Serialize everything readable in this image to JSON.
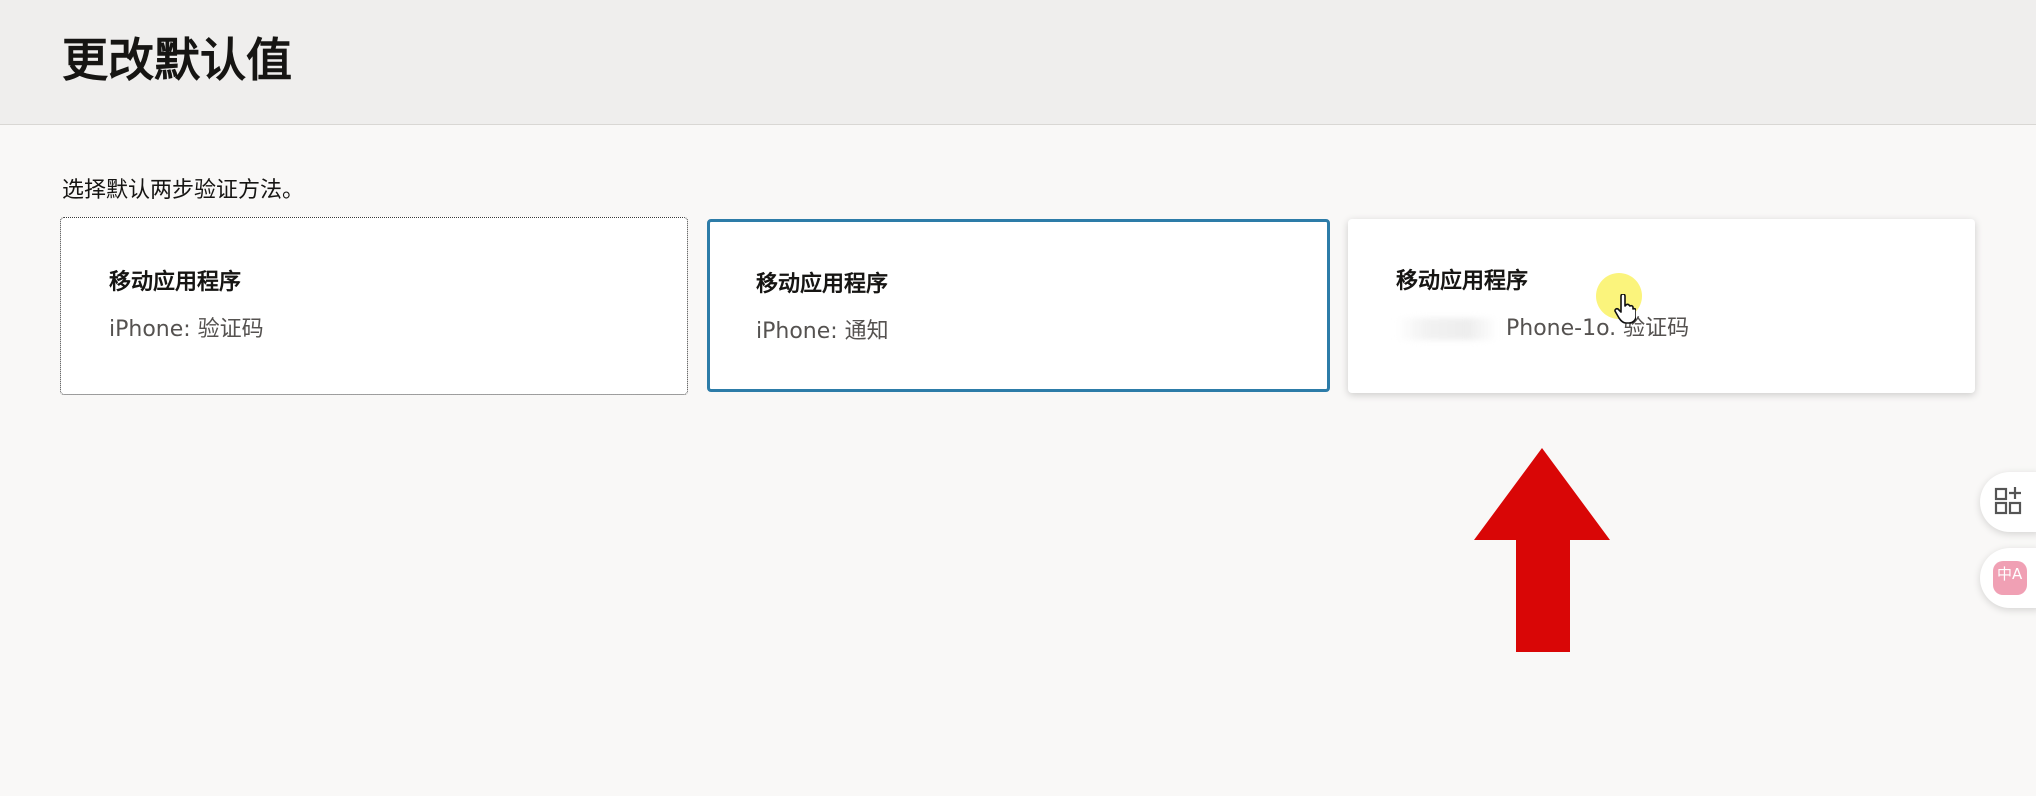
{
  "header": {
    "title": "更改默认值"
  },
  "main": {
    "instruction": "选择默认两步验证方法。",
    "options": [
      {
        "title": "移动应用程序",
        "subtitle": "iPhone: 验证码"
      },
      {
        "title": "移动应用程序",
        "subtitle": "iPhone: 通知"
      },
      {
        "title": "移动应用程序",
        "subtitle": "Phone-1o. 验证码"
      }
    ]
  },
  "side_tools": [
    {
      "icon": "apps-add-icon"
    },
    {
      "icon": "translate-icon",
      "label": "中A"
    }
  ],
  "colors": {
    "selected_border": "#2d7ca8",
    "arrow": "#d90606",
    "cursor_highlight": "#f8ee55"
  }
}
